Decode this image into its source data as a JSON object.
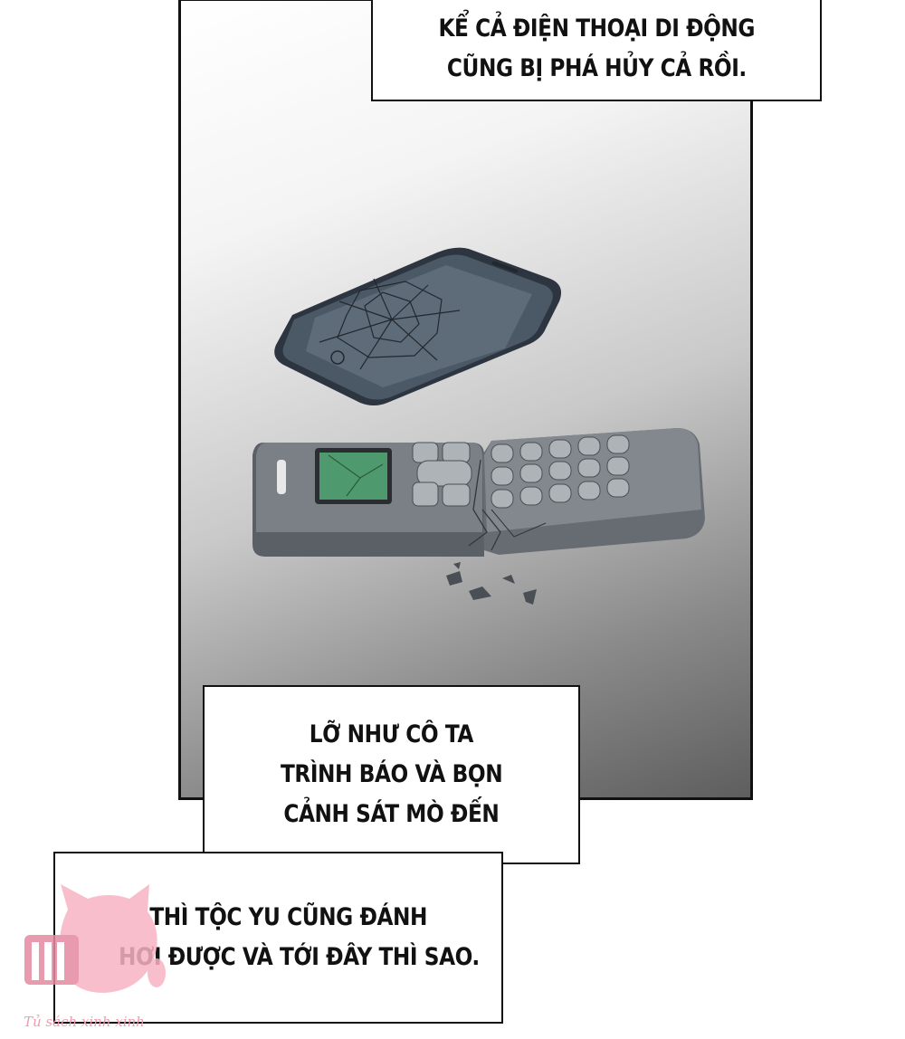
{
  "captions": {
    "top": [
      "KỂ CẢ ĐIỆN THOẠI DI ĐỘNG",
      "CŨNG BỊ PHÁ HỦY CẢ RỒI."
    ],
    "middle": [
      "LỠ NHƯ CÔ TA",
      "TRÌNH BÁO VÀ BỌN",
      "CẢNH SÁT MÒ ĐẾN"
    ],
    "bottom": [
      "THÌ TỘC YU CŨNG ĐÁNH",
      "HƠI ĐƯỢC VÀ TỚI ĐÂY THÌ SAO."
    ]
  },
  "watermark": {
    "text": "Tủ sách xinh xinh",
    "color": "#f19ab0"
  }
}
